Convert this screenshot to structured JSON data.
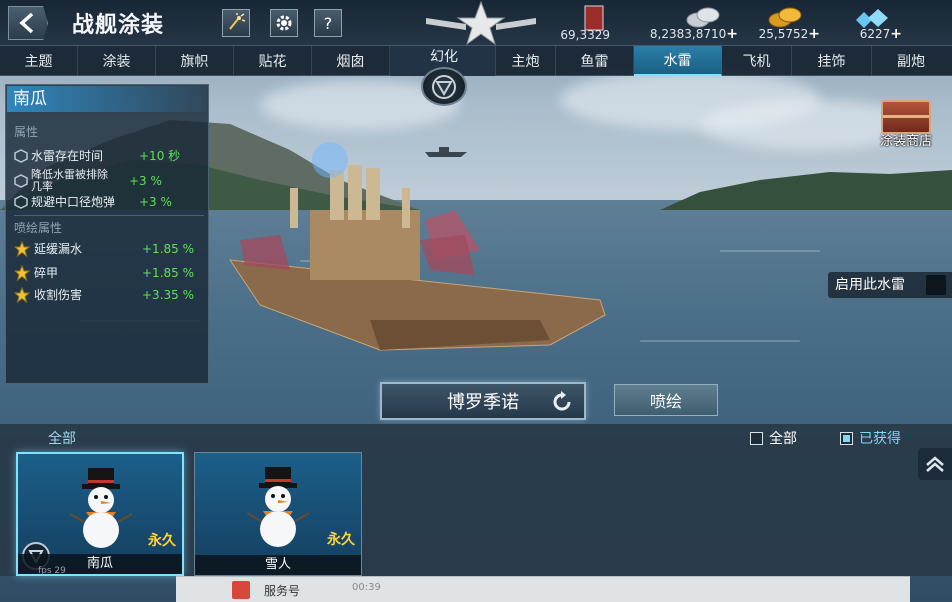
{
  "header": {
    "title": "战舰涂装",
    "help_label": "?"
  },
  "resources": [
    {
      "name": "fuel",
      "icon": "fuel-canister-icon",
      "value": "69,3329",
      "has_plus": false
    },
    {
      "name": "silver",
      "icon": "silver-coins-icon",
      "value": "8,2383,8710",
      "has_plus": true
    },
    {
      "name": "gold",
      "icon": "gold-coins-icon",
      "value": "25,5752",
      "has_plus": true
    },
    {
      "name": "diamond",
      "icon": "diamonds-icon",
      "value": "6227",
      "has_plus": true
    }
  ],
  "tabs": [
    {
      "label": "主题"
    },
    {
      "label": "涂装"
    },
    {
      "label": "旗帜"
    },
    {
      "label": "贴花"
    },
    {
      "label": "烟囱"
    },
    {
      "label": "幻化"
    },
    {
      "label": "主炮"
    },
    {
      "label": "鱼雷"
    },
    {
      "label": "水雷"
    },
    {
      "label": "飞机"
    },
    {
      "label": "挂饰"
    },
    {
      "label": "副炮"
    }
  ],
  "active_tab": "水雷",
  "panel": {
    "title": "南瓜",
    "attr_header": "属性",
    "attrs": [
      {
        "name": "水雷存在时间",
        "value": "+10 秒"
      },
      {
        "name": "降低水雷被排除几率",
        "value": "+3 %"
      },
      {
        "name": "规避中口径炮弹",
        "value": "+3 %"
      }
    ],
    "paint_header": "喷绘属性",
    "paint_attrs": [
      {
        "name": "延缓漏水",
        "value": "+1.85 %"
      },
      {
        "name": "碎甲",
        "value": "+1.85 %"
      },
      {
        "name": "收割伤害",
        "value": "+3.35 %"
      }
    ]
  },
  "shop_label": "涂装商店",
  "enable_label": "启用此水雷",
  "ship_name": "博罗季诺",
  "paint_button": "喷绘",
  "filters": {
    "tab_all": "全部",
    "all": "全部",
    "owned": "已获得",
    "owned_checked": true,
    "all_checked": false
  },
  "items": [
    {
      "name": "南瓜",
      "duration": "永久",
      "selected": true
    },
    {
      "name": "雪人",
      "duration": "永久",
      "selected": false
    }
  ],
  "fps_text": "fps 29",
  "taskbar": {
    "label": "服务号",
    "time": "00:39"
  }
}
